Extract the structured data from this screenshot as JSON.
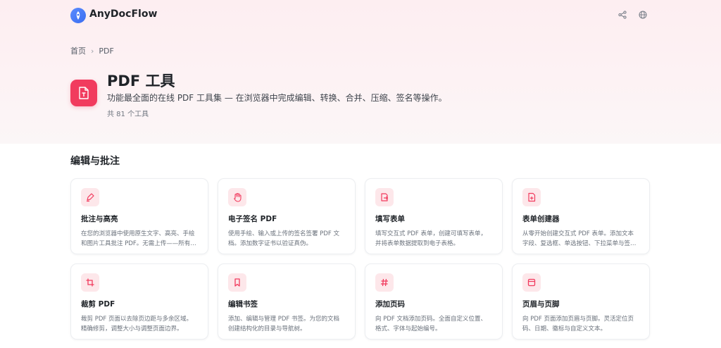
{
  "brand": {
    "name": "AnyDocFlow"
  },
  "header": {
    "icons": [
      "share-icon",
      "globe-icon"
    ]
  },
  "breadcrumb": {
    "home": "首页",
    "current": "PDF"
  },
  "page": {
    "title": "PDF 工具",
    "subtitle": "功能最全面的在线 PDF 工具集 — 在浏览器中完成编辑、转换、合并、压缩、签名等操作。",
    "count": "共 81 个工具",
    "icon": "pdf-text-icon"
  },
  "section": {
    "title": "编辑与批注"
  },
  "colors": {
    "accent": "#f13b5e",
    "icon_bg": "#fde7ea"
  },
  "tools": [
    {
      "icon": "pen-annotate-icon",
      "title": "批注与高亮",
      "desc": "在您的浏览器中使用原生文字、高亮、手绘和图片工具批注 PDF。无需上传——所有处理…"
    },
    {
      "icon": "hand-sign-icon",
      "title": "电子签名 PDF",
      "desc": "使用手绘、输入或上传的签名签署 PDF 文档。添加数字证书以验证真伪。"
    },
    {
      "icon": "form-fill-icon",
      "title": "填写表单",
      "desc": "填写交互式 PDF 表单，创建可填写表单，并将表单数据提取到电子表格。"
    },
    {
      "icon": "form-create-icon",
      "title": "表单创建器",
      "desc": "从零开始创建交互式 PDF 表单。添加文本字段、复选框、单选按钮、下拉菜单与签名字…"
    },
    {
      "icon": "crop-icon",
      "title": "裁剪 PDF",
      "desc": "裁剪 PDF 页面以去除页边距与多余区域。精确修剪，调整大小与调整页面边界。"
    },
    {
      "icon": "bookmark-icon",
      "title": "编辑书签",
      "desc": "添加、编辑与管理 PDF 书签。为您的文档创建结构化的目录与导航树。"
    },
    {
      "icon": "hash-icon",
      "title": "添加页码",
      "desc": "向 PDF 文档添加页码。全面自定义位置、格式、字体与起始编号。"
    },
    {
      "icon": "header-footer-icon",
      "title": "页眉与页脚",
      "desc": "向 PDF 页面添加页眉与页脚。灵活定位页码、日期、徽标与自定义文本。"
    }
  ]
}
